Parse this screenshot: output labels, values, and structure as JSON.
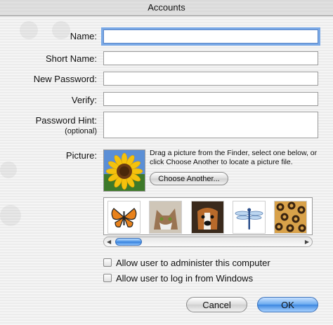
{
  "window": {
    "title": "Accounts"
  },
  "form": {
    "name_label": "Name:",
    "short_name_label": "Short Name:",
    "new_password_label": "New Password:",
    "verify_label": "Verify:",
    "password_hint_label": "Password Hint:",
    "optional_label": "(optional)",
    "name_value": "",
    "short_name_value": "",
    "new_password_value": "",
    "verify_value": "",
    "password_hint_value": ""
  },
  "picture": {
    "label": "Picture:",
    "help_text": "Drag a picture from the Finder, select one below, or click Choose Another to locate a picture file.",
    "choose_another_label": "Choose Another...",
    "thumbnails": [
      "butterfly",
      "cat",
      "dog",
      "dragonfly",
      "leopard"
    ]
  },
  "options": {
    "admin_label": "Allow user to administer this computer",
    "admin_checked": false,
    "windows_label": "Allow user to log in from Windows",
    "windows_checked": false
  },
  "buttons": {
    "cancel_label": "Cancel",
    "ok_label": "OK"
  },
  "colors": {
    "accent": "#3b86e0",
    "focus_ring": "#7aa9e6"
  }
}
